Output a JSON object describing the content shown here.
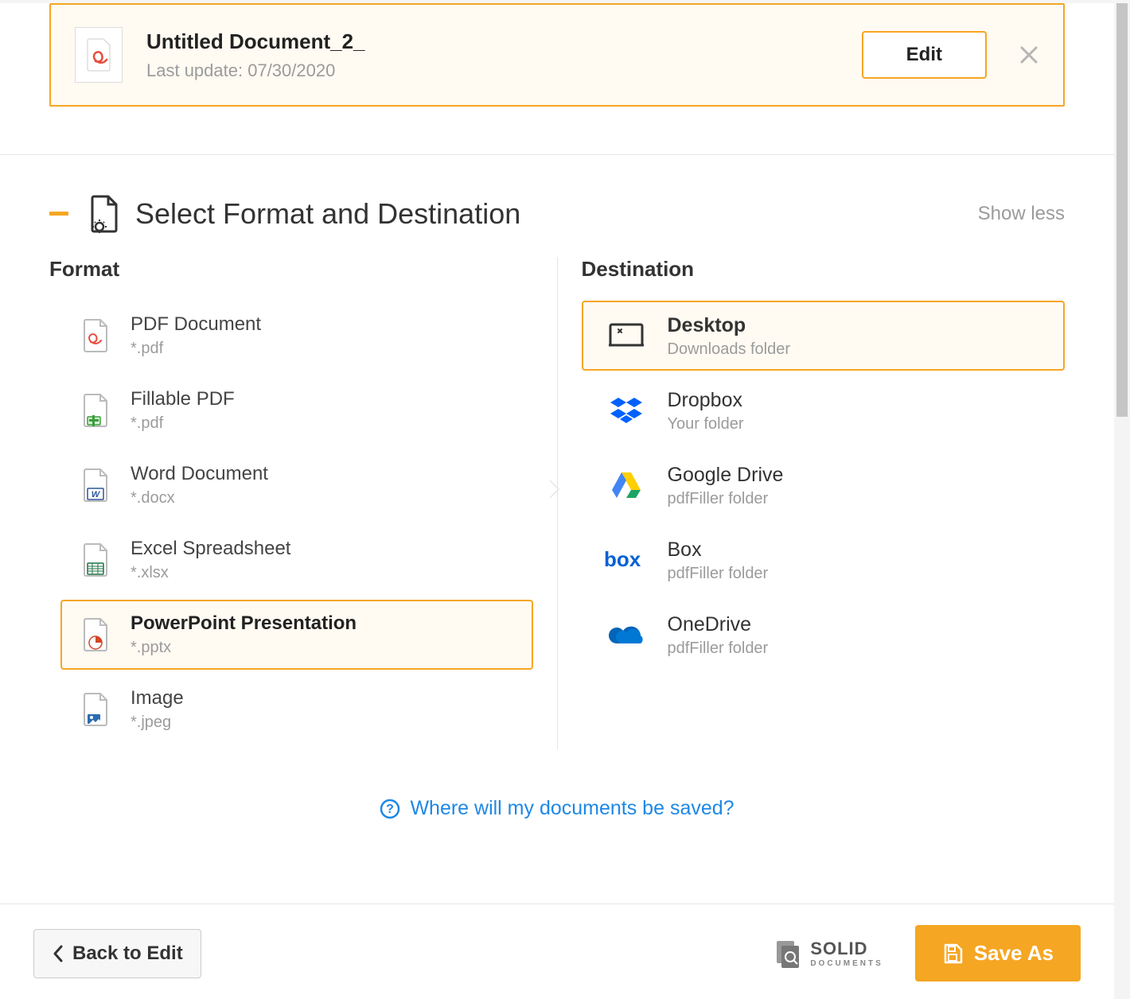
{
  "document": {
    "title": "Untitled Document_2_",
    "updated_prefix": "Last update: ",
    "updated_date": "07/30/2020",
    "edit_label": "Edit"
  },
  "section": {
    "title": "Select Format and Destination",
    "toggle_label": "Show less"
  },
  "format": {
    "heading": "Format",
    "options": [
      {
        "title": "PDF Document",
        "sub": "*.pdf",
        "selected": false
      },
      {
        "title": "Fillable PDF",
        "sub": "*.pdf",
        "selected": false
      },
      {
        "title": "Word Document",
        "sub": "*.docx",
        "selected": false
      },
      {
        "title": "Excel Spreadsheet",
        "sub": "*.xlsx",
        "selected": false
      },
      {
        "title": "PowerPoint Presentation",
        "sub": "*.pptx",
        "selected": true
      },
      {
        "title": "Image",
        "sub": "*.jpeg",
        "selected": false
      }
    ]
  },
  "destination": {
    "heading": "Destination",
    "options": [
      {
        "title": "Desktop",
        "sub": "Downloads folder",
        "selected": true
      },
      {
        "title": "Dropbox",
        "sub": "Your folder",
        "selected": false
      },
      {
        "title": "Google Drive",
        "sub": "pdfFiller folder",
        "selected": false
      },
      {
        "title": "Box",
        "sub": "pdfFiller folder",
        "selected": false
      },
      {
        "title": "OneDrive",
        "sub": "pdfFiller folder",
        "selected": false
      }
    ]
  },
  "help": {
    "text": "Where will my documents be saved?"
  },
  "footer": {
    "back_label": "Back to Edit",
    "solid_label": "SOLID",
    "solid_sub": "DOCUMENTS",
    "save_label": "Save As"
  },
  "colors": {
    "accent": "#f5a623",
    "link": "#1e88e5"
  }
}
